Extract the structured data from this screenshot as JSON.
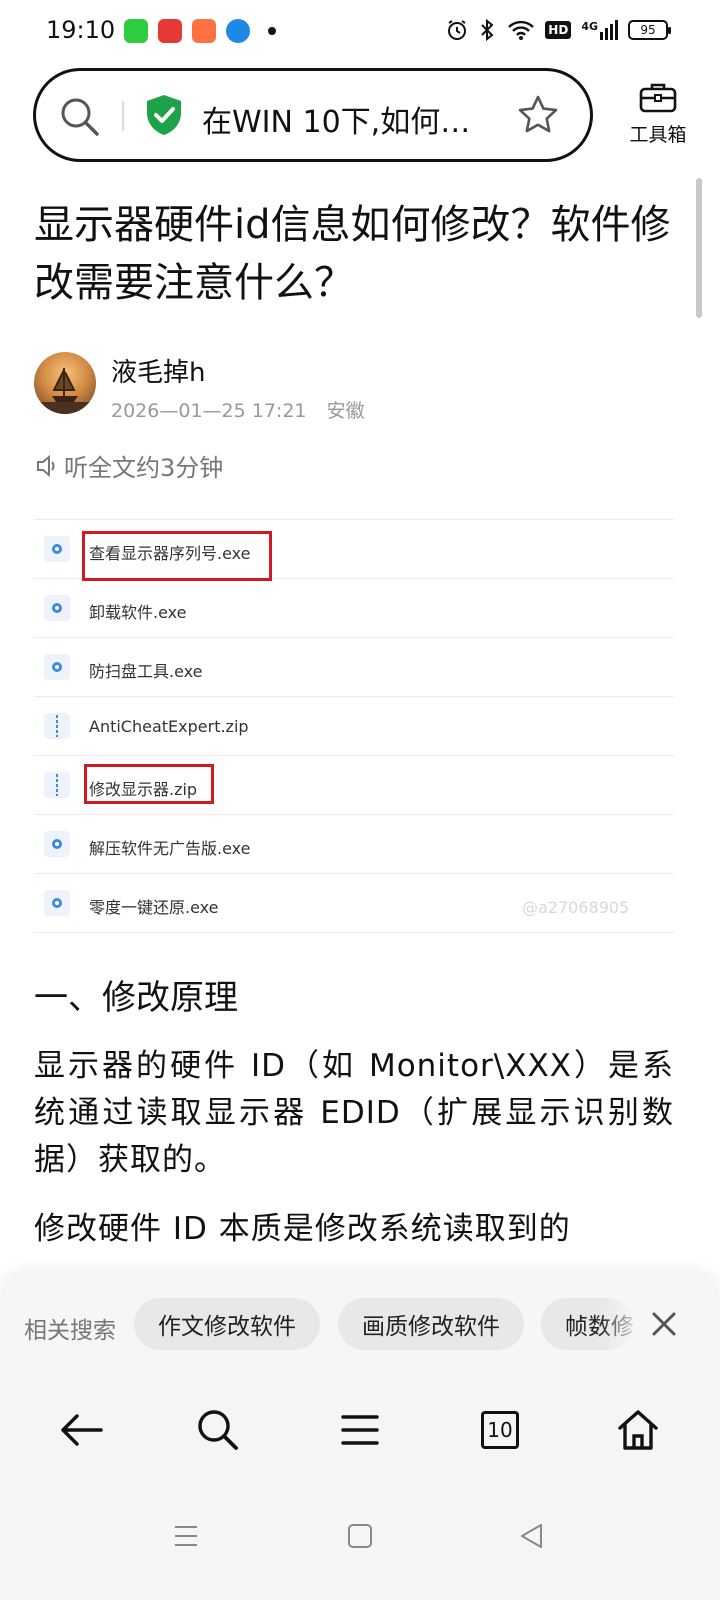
{
  "status_bar": {
    "time": "19:10",
    "app_icons": [
      "app-green-icon",
      "toutiao-icon",
      "app-orange-icon",
      "browser-blue-icon"
    ],
    "battery": "95",
    "network": "4G",
    "hd_label": "HD"
  },
  "address_bar": {
    "text": "在WIN 10下,如何…"
  },
  "toolbox": {
    "label": "工具箱"
  },
  "article": {
    "title": "显示器硬件id信息如何修改？软件修改需要注意什么？",
    "author": "液毛掉h",
    "date": "2026—01—25  17:21",
    "location": "安徽",
    "listen": "听全文约3分钟",
    "files": [
      {
        "name": "查看显示器序列号.exe",
        "type": "exe",
        "highlighted": true
      },
      {
        "name": "卸载软件.exe",
        "type": "exe",
        "highlighted": false
      },
      {
        "name": "防扫盘工具.exe",
        "type": "exe",
        "highlighted": false
      },
      {
        "name": "AntiCheatExpert.zip",
        "type": "zip",
        "highlighted": false
      },
      {
        "name": "修改显示器.zip",
        "type": "zip",
        "highlighted": true
      },
      {
        "name": "解压软件无广告版.exe",
        "type": "exe",
        "highlighted": false
      },
      {
        "name": "零度一键还原.exe",
        "type": "exe",
        "highlighted": false
      }
    ],
    "watermark": "@a27068905",
    "section_heading": "一、修改原理",
    "paragraph_1": "显示器的硬件 ID（如 Monitor\\XXX）是系统通过读取显示器 EDID（扩展显示识别数据）获取的。",
    "paragraph_2": "修改硬件 ID 本质是修改系统读取到的"
  },
  "related_search": {
    "label": "相关搜索",
    "chips": [
      "作文修改软件",
      "画质修改软件",
      "帧数修"
    ]
  },
  "bottom_bar": {
    "tabs_count": "10"
  },
  "colors": {
    "highlight": "#d01920",
    "shield": "#1ca34a",
    "chip_bg": "#e8e8e8"
  }
}
